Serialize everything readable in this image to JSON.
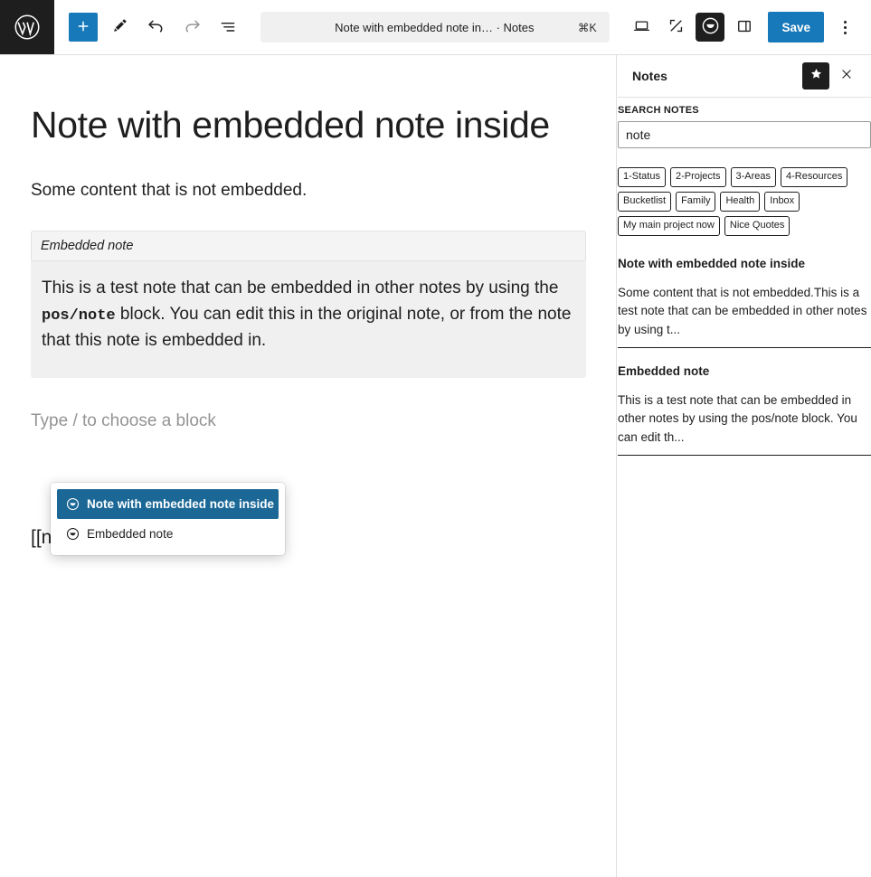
{
  "theme": {
    "accent_blue": "#1779ba",
    "selected_blue": "#1b6897",
    "dark": "#1e1e1e",
    "panel_gray": "#f0f0f0",
    "placeholder_gray": "#949494"
  },
  "toolbar": {
    "logo_name": "wordpress-logo",
    "add_block_label": "+",
    "tools": [
      {
        "name": "add-block-button",
        "icon": "plus-icon",
        "label": "Add block"
      },
      {
        "name": "tools-button",
        "icon": "pencil-icon",
        "label": "Tools"
      },
      {
        "name": "undo-button",
        "icon": "undo-arrow-icon",
        "label": "Undo"
      },
      {
        "name": "redo-button",
        "icon": "redo-arrow-icon",
        "label": "Redo"
      },
      {
        "name": "document-overview-button",
        "icon": "list-view-icon",
        "label": "Document Overview"
      }
    ],
    "command_bar": {
      "label": "Note with embedded note in…  · Notes",
      "shortcut": "⌘K"
    },
    "right_tools": [
      {
        "name": "view-button",
        "icon": "desktop-icon",
        "label": "View"
      },
      {
        "name": "zoom-out-button",
        "icon": "expand-corners-icon",
        "label": "Zoom out"
      },
      {
        "name": "notes-plugin-button",
        "icon": "circle-chevron-down-icon",
        "label": "Notes",
        "active": true
      },
      {
        "name": "settings-sidebar-button",
        "icon": "sidebar-panel-icon",
        "label": "Settings"
      }
    ],
    "save_label": "Save",
    "options_label": "Options"
  },
  "editor": {
    "title": "Note with embedded note inside",
    "paragraph": "Some content that is not embedded.",
    "embedded_block": {
      "header": "Embedded note",
      "body_before_code": "This is a test note that can be embedded in other notes by using the ",
      "code": "pos/note",
      "body_after_code": " block. You can edit this in the original note, or from the note that this note is embedded in."
    },
    "empty_block_placeholder": "Type / to choose a block",
    "typed_text": "[[note"
  },
  "autocomplete": {
    "items": [
      {
        "label": "Note with embedded note inside",
        "icon": "circle-chevron-down-icon",
        "selected": true
      },
      {
        "label": "Embedded note",
        "icon": "circle-chevron-down-icon",
        "selected": false
      }
    ]
  },
  "sidebar": {
    "title": "Notes",
    "pin_icon": "star-icon",
    "close_icon": "close-icon",
    "search": {
      "label": "SEARCH NOTES",
      "value": "note",
      "placeholder": "Search notes"
    },
    "tags": [
      "1-Status",
      "2-Projects",
      "3-Areas",
      "4-Resources",
      "Bucketlist",
      "Family",
      "Health",
      "Inbox",
      "My main project now",
      "Nice Quotes"
    ],
    "results": [
      {
        "title": "Note with embedded note inside",
        "excerpt": "Some content that is not embedded.This is a test note that can be embedded in other notes by using t..."
      },
      {
        "title": "Embedded note",
        "excerpt": "This is a test note that can be embedded in other notes by using the pos/note block. You can edit th..."
      }
    ]
  }
}
